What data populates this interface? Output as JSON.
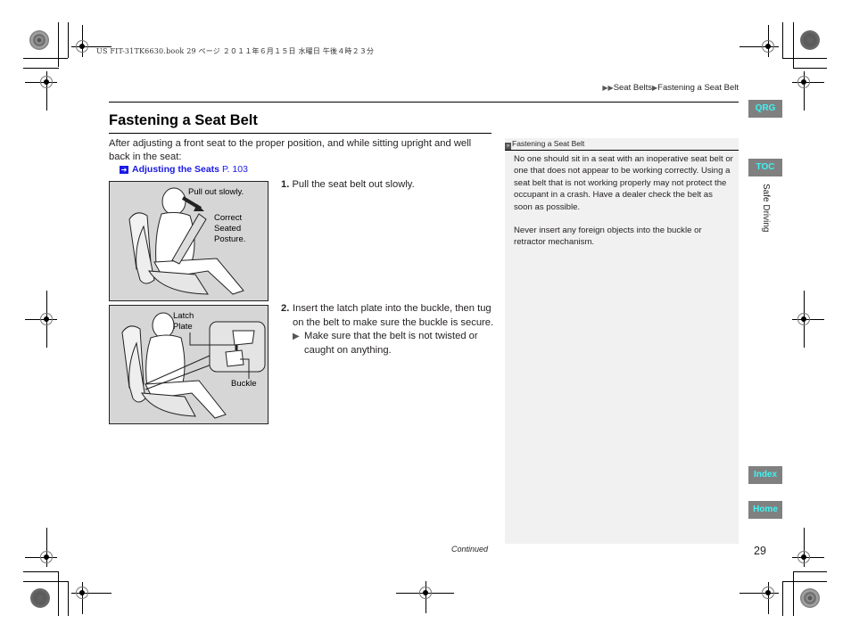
{
  "print_header": {
    "file_info": "US FIT-31TK6630.book  29 ページ  ２０１１年６月１５日  水曜日  午後４時２３分"
  },
  "breadcrumb": {
    "items": [
      "Seat Belts",
      "Fastening a Seat Belt"
    ],
    "separator_icon": "right-triangle-icon"
  },
  "page": {
    "title": "Fastening a Seat Belt",
    "intro": "After adjusting a front seat to the proper position, and while sitting upright and well back in the seat:",
    "xref": {
      "label": "Adjusting the Seats",
      "page": "P. 103",
      "icon": "cross-reference-arrow-icon"
    }
  },
  "figures": [
    {
      "name": "pull-belt-illustration",
      "labels": [
        "Pull out slowly.",
        "Correct Seated Posture."
      ]
    },
    {
      "name": "insert-latch-illustration",
      "labels": [
        "Latch Plate",
        "Buckle"
      ]
    }
  ],
  "steps": [
    {
      "num": "1.",
      "text": "Pull the seat belt out slowly."
    },
    {
      "num": "2.",
      "text": "Insert the latch plate into the buckle, then tug on the belt to make sure the buckle is secure.",
      "sub": "Make sure that the belt is not twisted or caught on anything."
    }
  ],
  "sidebar_note": {
    "header": "Fastening a Seat Belt",
    "paragraphs": [
      "No one should sit in a seat with an inoperative seat belt or one that does not appear to be working correctly. Using a seat belt that is not working properly may not protect the occupant in a crash. Have a dealer check the belt as soon as possible.",
      "Never insert any foreign objects into the buckle or retractor mechanism."
    ]
  },
  "nav": {
    "qrg": "QRG",
    "toc": "TOC",
    "index": "Index",
    "home": "Home",
    "section": "Safe Driving",
    "button_bg": "#808080",
    "button_fg": "#3ff3f3"
  },
  "footer": {
    "continued": "Continued",
    "page_number": "29"
  }
}
